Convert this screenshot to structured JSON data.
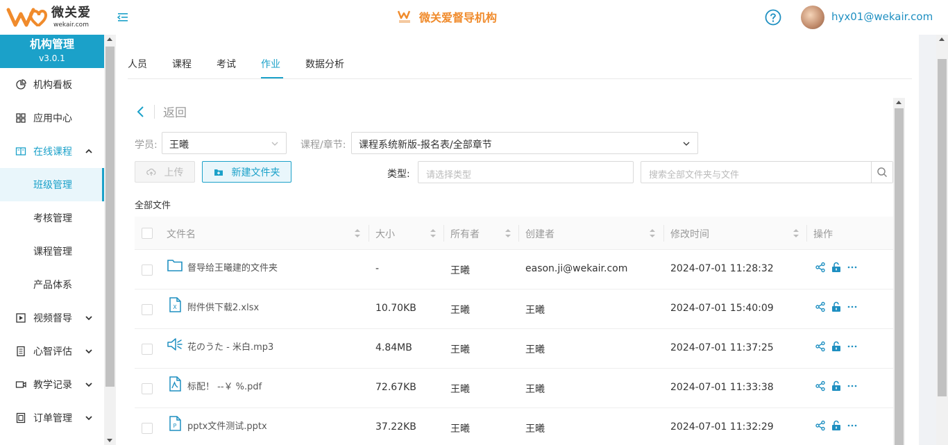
{
  "header": {
    "logo_cn": "微关爱",
    "logo_en": "wekair.com",
    "brand_title": "微关爱督导机构",
    "user_email": "hyx01@wekair.com"
  },
  "sidebar": {
    "title": "机构管理",
    "version": "v3.0.1",
    "items": [
      {
        "label": "机构看板",
        "icon": "pie-chart-icon"
      },
      {
        "label": "应用中心",
        "icon": "grid-icon"
      },
      {
        "label": "在线课程",
        "icon": "book-icon",
        "expanded": true
      },
      {
        "label": "班级管理",
        "sub": true,
        "active": true
      },
      {
        "label": "考核管理",
        "sub": true
      },
      {
        "label": "课程管理",
        "sub": true
      },
      {
        "label": "产品体系",
        "sub": true
      },
      {
        "label": "视频督导",
        "icon": "video-icon"
      },
      {
        "label": "心智评估",
        "icon": "report-icon"
      },
      {
        "label": "教学记录",
        "icon": "camera-icon"
      },
      {
        "label": "订单管理",
        "icon": "order-icon"
      }
    ]
  },
  "tabs": [
    "人员",
    "课程",
    "考试",
    "作业",
    "数据分析"
  ],
  "active_tab": "作业",
  "back_label": "返回",
  "filters": {
    "student_label": "学员:",
    "student_value": "王曦",
    "course_label": "课程/章节:",
    "course_value": "课程系统新版-报名表/全部章节",
    "type_label": "类型:",
    "type_placeholder": "请选择类型",
    "search_placeholder": "搜索全部文件夹与文件"
  },
  "buttons": {
    "upload": "上传",
    "new_folder": "新建文件夹"
  },
  "all_files_label": "全部文件",
  "table": {
    "headers": [
      "文件名",
      "大小",
      "所有者",
      "创建者",
      "修改时间",
      "操作"
    ],
    "rows": [
      {
        "icon": "folder-icon",
        "name": "督导给王曦建的文件夹",
        "size": "-",
        "owner": "王曦",
        "creator": "eason.ji@wekair.com",
        "modified": "2024-07-01 11:28:32"
      },
      {
        "icon": "excel-file-icon",
        "name": "附件供下载2.xlsx",
        "size": "10.70KB",
        "owner": "王曦",
        "creator": "王曦",
        "modified": "2024-07-01 15:40:09"
      },
      {
        "icon": "audio-file-icon",
        "name": "花のうた - 米白.mp3",
        "size": "4.84MB",
        "owner": "王曦",
        "creator": "王曦",
        "modified": "2024-07-01 11:37:25"
      },
      {
        "icon": "pdf-file-icon",
        "name": "标配！ --￥ %.pdf",
        "size": "72.67KB",
        "owner": "王曦",
        "creator": "王曦",
        "modified": "2024-07-01 11:33:38"
      },
      {
        "icon": "ppt-file-icon",
        "name": "pptx文件测试.pptx",
        "size": "37.22KB",
        "owner": "王曦",
        "creator": "王曦",
        "modified": "2024-07-01 11:32:29"
      }
    ]
  },
  "colors": {
    "accent": "#1ba1c9",
    "brand_orange": "#f08b2c"
  }
}
